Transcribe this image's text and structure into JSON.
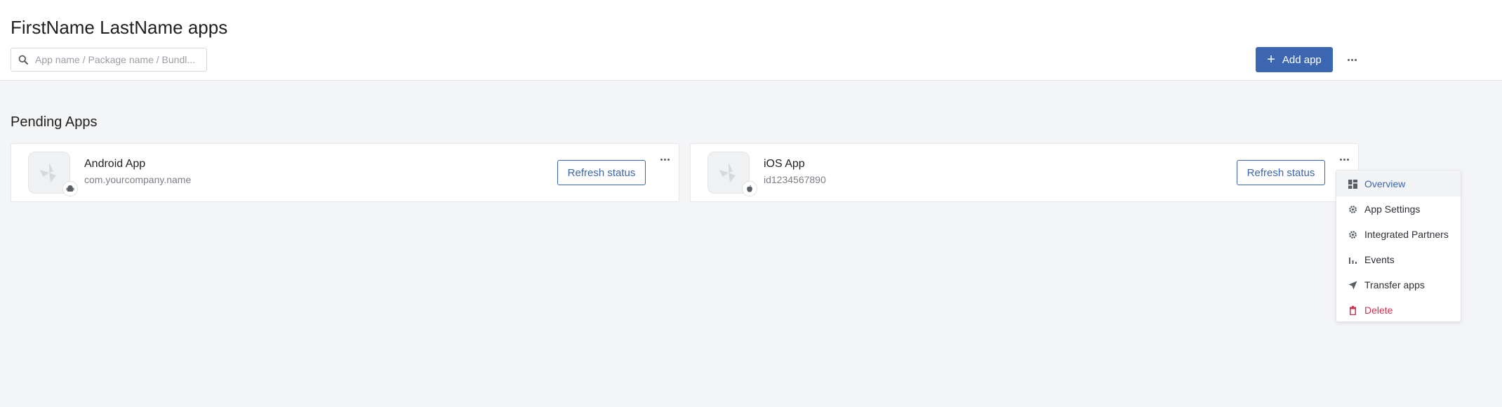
{
  "header": {
    "title": "FirstName LastName apps",
    "search_placeholder": "App name / Package name / Bundl...",
    "search_value": "",
    "add_app_label": "Add app",
    "add_app_icon": "plus-icon",
    "more_icon": "more-horizontal-icon"
  },
  "pending": {
    "title": "Pending Apps",
    "apps": [
      {
        "name": "Android App",
        "identifier": "com.yourcompany.name",
        "platform_icon": "android-icon",
        "refresh_label": "Refresh status"
      },
      {
        "name": "iOS App",
        "identifier": "id1234567890",
        "platform_icon": "apple-icon",
        "refresh_label": "Refresh status"
      }
    ]
  },
  "context_menu": {
    "items": [
      {
        "label": "Overview",
        "icon": "dashboard-icon",
        "active": true
      },
      {
        "label": "App Settings",
        "icon": "gear-icon"
      },
      {
        "label": "Integrated Partners",
        "icon": "gear-icon"
      },
      {
        "label": "Events",
        "icon": "bar-chart-icon"
      },
      {
        "label": "Transfer apps",
        "icon": "send-icon"
      },
      {
        "label": "Delete",
        "icon": "trash-icon",
        "danger": true
      }
    ]
  },
  "colors": {
    "accent": "#3c66b0",
    "danger": "#d0304f",
    "background": "#f4f5f7"
  }
}
